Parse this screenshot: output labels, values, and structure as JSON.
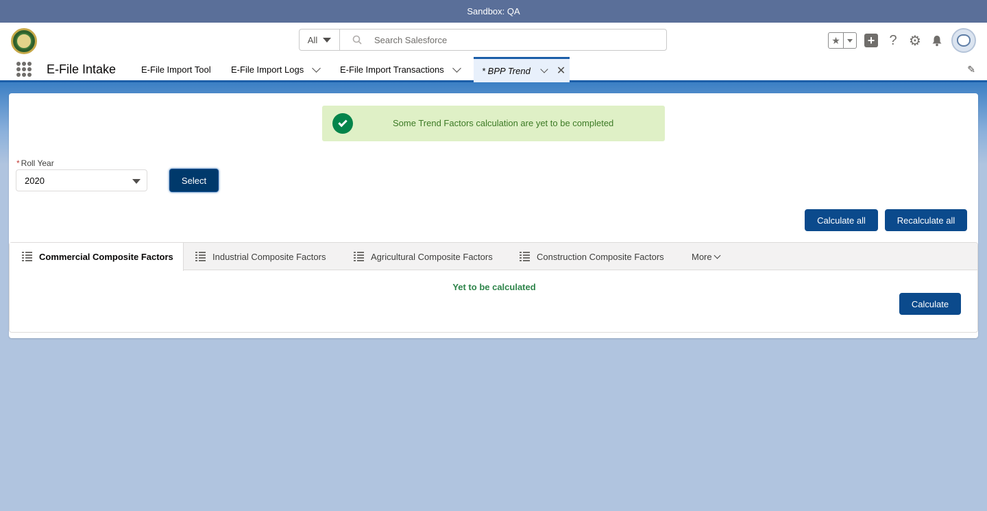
{
  "sandbox": {
    "label": "Sandbox: QA"
  },
  "header": {
    "search_scope": "All",
    "search_placeholder": "Search Salesforce"
  },
  "nav": {
    "app_name": "E-File Intake",
    "items": [
      {
        "label": "E-File Import Tool"
      },
      {
        "label": "E-File Import Logs"
      },
      {
        "label": "E-File Import Transactions"
      }
    ],
    "active_tab": {
      "label": "* BPP Trend"
    }
  },
  "toast": {
    "message": "Some Trend Factors calculation are yet to be completed"
  },
  "form": {
    "roll_year_label": "Roll Year",
    "roll_year_value": "2020",
    "select_button": "Select",
    "calculate_all_button": "Calculate all",
    "recalculate_all_button": "Recalculate all"
  },
  "tabs": {
    "items": [
      {
        "label": "Commercial Composite Factors"
      },
      {
        "label": "Industrial Composite Factors"
      },
      {
        "label": "Agricultural Composite Factors"
      },
      {
        "label": "Construction Composite Factors"
      }
    ],
    "more_label": "More",
    "status_text": "Yet to be calculated",
    "calculate_button": "Calculate"
  }
}
